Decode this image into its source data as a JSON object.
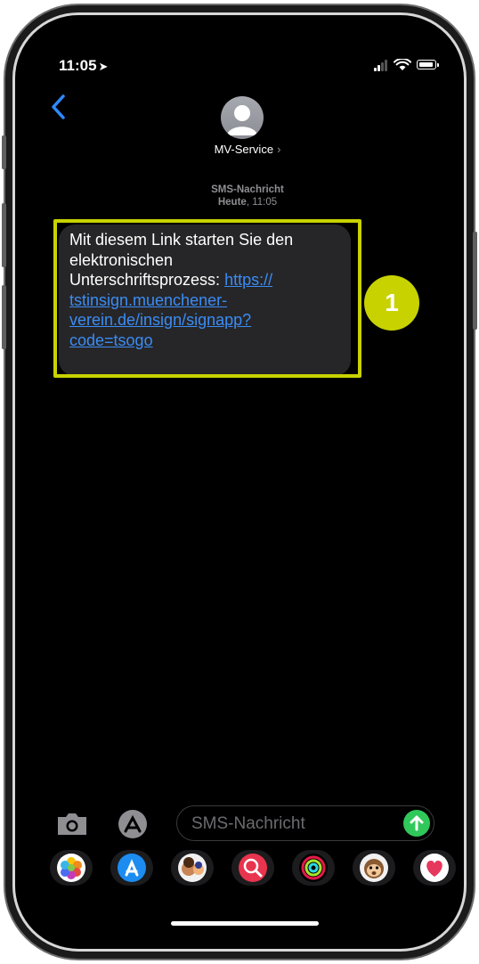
{
  "status_bar": {
    "time": "11:05",
    "location_arrow": "➤"
  },
  "header": {
    "contact_name": "MV-Service",
    "chevron": "›"
  },
  "conversation": {
    "message_type": "SMS-Nachricht",
    "day": "Heute",
    "time": "11:05"
  },
  "message": {
    "line1": "Mit diesem Link starten Sie den",
    "line2": "elektronischen",
    "line3": "Unterschriftsprozess: ",
    "link_part1": "https://",
    "link_part2": "tstinsign.muenchener-",
    "link_part3": "verein.de/insign/signapp?",
    "link_part4": "code=tsogo"
  },
  "annotation": {
    "badge_number": "1",
    "color": "#c8d200"
  },
  "input": {
    "placeholder": "SMS-Nachricht"
  },
  "app_drawer": {
    "apps": [
      "photos-icon",
      "app-store-icon",
      "memoji-icon",
      "images-search-icon",
      "activity-icon",
      "animoji-icon",
      "heart-sticker-icon"
    ]
  },
  "colors": {
    "link": "#3b8cf5",
    "send": "#30c85a",
    "bubble": "#262628"
  }
}
